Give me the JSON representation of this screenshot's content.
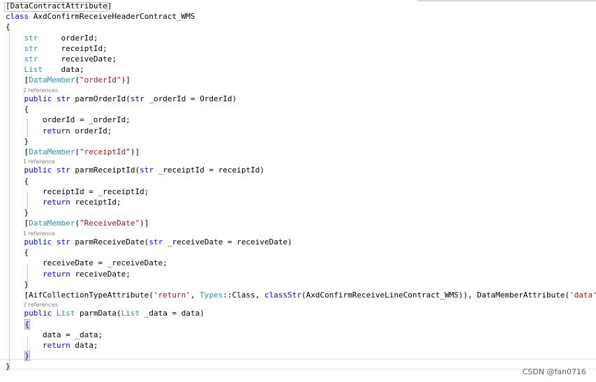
{
  "code": {
    "lines": [
      {
        "tokens": [
          {
            "text": "[DataContractAttribute]",
            "kind": "pl"
          }
        ]
      },
      {
        "tokens": [
          {
            "text": "class",
            "kind": "kw"
          },
          {
            "text": " AxdConfirmReceiveHeaderContract_WMS",
            "kind": "pl"
          }
        ]
      },
      {
        "tokens": [
          {
            "text": "{",
            "kind": "pl"
          }
        ]
      },
      {
        "tokens": [
          {
            "text": "    ",
            "kind": "pl"
          },
          {
            "text": "str",
            "kind": "ty"
          },
          {
            "text": "     orderId;",
            "kind": "pl"
          }
        ]
      },
      {
        "tokens": [
          {
            "text": "    ",
            "kind": "pl"
          },
          {
            "text": "str",
            "kind": "ty"
          },
          {
            "text": "     receiptId;",
            "kind": "pl"
          }
        ]
      },
      {
        "tokens": [
          {
            "text": "    ",
            "kind": "pl"
          },
          {
            "text": "str",
            "kind": "ty"
          },
          {
            "text": "     receiveDate;",
            "kind": "pl"
          }
        ]
      },
      {
        "tokens": [
          {
            "text": "    ",
            "kind": "pl"
          },
          {
            "text": "List",
            "kind": "ty"
          },
          {
            "text": "    data;",
            "kind": "pl"
          }
        ]
      },
      {
        "tokens": [
          {
            "text": "    [",
            "kind": "pl"
          },
          {
            "text": "DataMember",
            "kind": "ty"
          },
          {
            "text": "(",
            "kind": "pl"
          },
          {
            "text": "\"orderId\"",
            "kind": "str"
          },
          {
            "text": ")]",
            "kind": "pl"
          }
        ]
      },
      {
        "lens": "2 references"
      },
      {
        "tokens": [
          {
            "text": "    ",
            "kind": "pl"
          },
          {
            "text": "public",
            "kind": "kw"
          },
          {
            "text": " ",
            "kind": "pl"
          },
          {
            "text": "str",
            "kind": "kw"
          },
          {
            "text": " parmOrderId(",
            "kind": "pl"
          },
          {
            "text": "str",
            "kind": "kw"
          },
          {
            "text": " _orderId = OrderId)",
            "kind": "pl"
          }
        ]
      },
      {
        "tokens": [
          {
            "text": "    {",
            "kind": "pl"
          }
        ]
      },
      {
        "tokens": [
          {
            "text": "        orderId = _orderId;",
            "kind": "pl"
          }
        ]
      },
      {
        "tokens": [
          {
            "text": "        ",
            "kind": "pl"
          },
          {
            "text": "return",
            "kind": "kw"
          },
          {
            "text": " orderId;",
            "kind": "pl"
          }
        ]
      },
      {
        "tokens": [
          {
            "text": "    }",
            "kind": "pl"
          }
        ]
      },
      {
        "tokens": [
          {
            "text": "    [",
            "kind": "pl"
          },
          {
            "text": "DataMember",
            "kind": "ty"
          },
          {
            "text": "(",
            "kind": "pl"
          },
          {
            "text": "\"receiptId\"",
            "kind": "str"
          },
          {
            "text": ")]",
            "kind": "pl"
          }
        ]
      },
      {
        "lens": "1 reference"
      },
      {
        "tokens": [
          {
            "text": "    ",
            "kind": "pl"
          },
          {
            "text": "public",
            "kind": "kw"
          },
          {
            "text": " ",
            "kind": "pl"
          },
          {
            "text": "str",
            "kind": "kw"
          },
          {
            "text": " parmReceiptId(",
            "kind": "pl"
          },
          {
            "text": "str",
            "kind": "kw"
          },
          {
            "text": " _receiptId = receiptId)",
            "kind": "pl"
          }
        ]
      },
      {
        "tokens": [
          {
            "text": "    {",
            "kind": "pl"
          }
        ]
      },
      {
        "tokens": [
          {
            "text": "        receiptId = _receiptId;",
            "kind": "pl"
          }
        ]
      },
      {
        "tokens": [
          {
            "text": "        ",
            "kind": "pl"
          },
          {
            "text": "return",
            "kind": "kw"
          },
          {
            "text": " receiptId;",
            "kind": "pl"
          }
        ]
      },
      {
        "tokens": [
          {
            "text": "    }",
            "kind": "pl"
          }
        ]
      },
      {
        "tokens": [
          {
            "text": "    [",
            "kind": "pl"
          },
          {
            "text": "DataMember",
            "kind": "ty"
          },
          {
            "text": "(",
            "kind": "pl"
          },
          {
            "text": "\"ReceiveDate\"",
            "kind": "str"
          },
          {
            "text": ")]",
            "kind": "pl"
          }
        ]
      },
      {
        "lens": "1 reference"
      },
      {
        "tokens": [
          {
            "text": "    ",
            "kind": "pl"
          },
          {
            "text": "public",
            "kind": "kw"
          },
          {
            "text": " ",
            "kind": "pl"
          },
          {
            "text": "str",
            "kind": "kw"
          },
          {
            "text": " parmReceiveDate(",
            "kind": "pl"
          },
          {
            "text": "str",
            "kind": "kw"
          },
          {
            "text": " _receiveDate = receiveDate)",
            "kind": "pl"
          }
        ]
      },
      {
        "tokens": [
          {
            "text": "    {",
            "kind": "pl"
          }
        ]
      },
      {
        "tokens": [
          {
            "text": "        receiveDate = _receiveDate;",
            "kind": "pl"
          }
        ]
      },
      {
        "tokens": [
          {
            "text": "        ",
            "kind": "pl"
          },
          {
            "text": "return",
            "kind": "kw"
          },
          {
            "text": " receiveDate;",
            "kind": "pl"
          }
        ]
      },
      {
        "tokens": [
          {
            "text": "    }",
            "kind": "pl"
          }
        ]
      },
      {
        "tokens": [
          {
            "text": "    [AifCollectionTypeAttribute(",
            "kind": "pl"
          },
          {
            "text": "'return'",
            "kind": "str"
          },
          {
            "text": ", ",
            "kind": "pl"
          },
          {
            "text": "Types",
            "kind": "ty"
          },
          {
            "text": "::Class, ",
            "kind": "pl"
          },
          {
            "text": "classStr",
            "kind": "kw"
          },
          {
            "text": "(AxdConfirmReceiveLineContract_WMS)), DataMemberAttribute(",
            "kind": "pl"
          },
          {
            "text": "'data'",
            "kind": "str"
          },
          {
            "text": ")]",
            "kind": "pl"
          }
        ]
      },
      {
        "lens": "2 references"
      },
      {
        "tokens": [
          {
            "text": "    ",
            "kind": "pl"
          },
          {
            "text": "public",
            "kind": "kw"
          },
          {
            "text": " ",
            "kind": "pl"
          },
          {
            "text": "List",
            "kind": "ty"
          },
          {
            "text": " parmData(",
            "kind": "pl"
          },
          {
            "text": "List",
            "kind": "ty"
          },
          {
            "text": " _data = data)",
            "kind": "pl"
          }
        ]
      },
      {
        "tokens": [
          {
            "text": "    ",
            "kind": "pl"
          },
          {
            "text": "{",
            "kind": "brace"
          }
        ]
      },
      {
        "tokens": [
          {
            "text": "        data = _data;",
            "kind": "pl"
          }
        ]
      },
      {
        "tokens": [
          {
            "text": "        ",
            "kind": "pl"
          },
          {
            "text": "return",
            "kind": "kw"
          },
          {
            "text": " data;",
            "kind": "pl"
          }
        ]
      },
      {
        "tokens": [
          {
            "text": "    ",
            "kind": "pl"
          },
          {
            "text": "}",
            "kind": "brace"
          }
        ]
      },
      {
        "tokens": [
          {
            "text": "}",
            "kind": "pl"
          }
        ]
      }
    ]
  },
  "watermark": "CSDN @fan0716"
}
